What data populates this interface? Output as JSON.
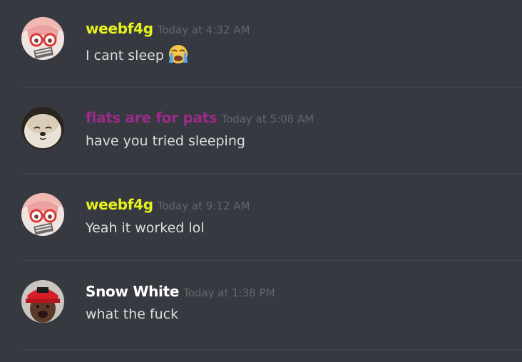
{
  "colors": {
    "background": "#36393f",
    "weebf4g": "#e5f21e",
    "flats": "#9c2a89",
    "snow_white": "#ffffff",
    "text": "#dcddde",
    "timestamp": "#63666b"
  },
  "messages": [
    {
      "username": "weebf4g",
      "timestamp": "Today at 4:32 AM",
      "text": "I cant sleep",
      "emoji": "sob-emoji",
      "avatar": "anime-girl-glasses-avatar"
    },
    {
      "username": "flats are for pats",
      "timestamp": "Today at 5:08 AM",
      "text": "have you tried sleeping",
      "avatar": "shiba-dog-avatar"
    },
    {
      "username": "weebf4g",
      "timestamp": "Today at 9:12 AM",
      "text": "Yeah it worked lol",
      "avatar": "anime-girl-glasses-avatar"
    },
    {
      "username": "Snow White",
      "timestamp": "Today at 1:38 PM",
      "text": "what the fuck",
      "avatar": "man-red-cap-avatar"
    }
  ]
}
